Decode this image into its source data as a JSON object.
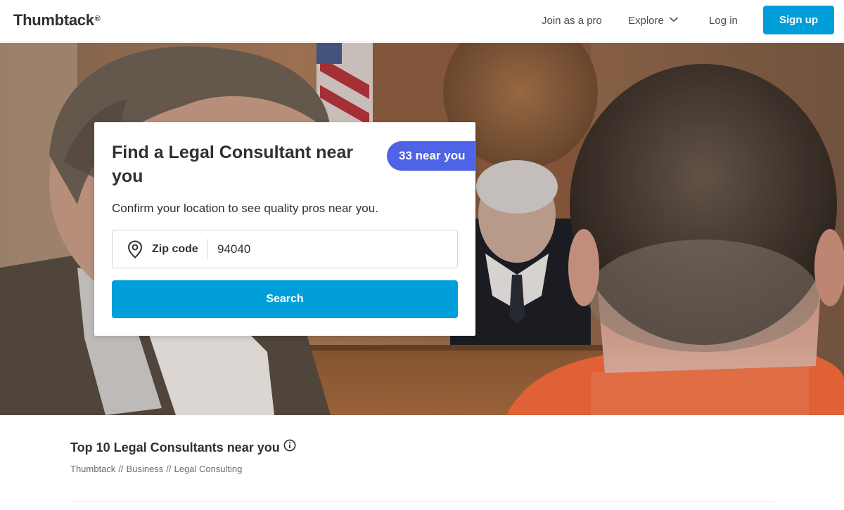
{
  "header": {
    "logo": "Thumbtack",
    "logo_mark": "®",
    "nav": {
      "join_pro": "Join as a pro",
      "explore": "Explore",
      "login": "Log in",
      "signup": "Sign up"
    },
    "brand_color": "#009fd9"
  },
  "hero": {
    "title": "Find a Legal Consultant near you",
    "badge": "33 near you",
    "badge_color": "#4e63e6",
    "subtitle": "Confirm your location to see quality pros near you.",
    "zip": {
      "label": "Zip code",
      "value": "94040",
      "icon": "location-pin-icon"
    },
    "search_button": "Search"
  },
  "listing": {
    "title": "Top 10 Legal Consultants near you",
    "info_icon": "info-icon",
    "breadcrumb": [
      "Thumbtack",
      "Business",
      "Legal Consulting"
    ],
    "breadcrumb_separator": "//"
  }
}
